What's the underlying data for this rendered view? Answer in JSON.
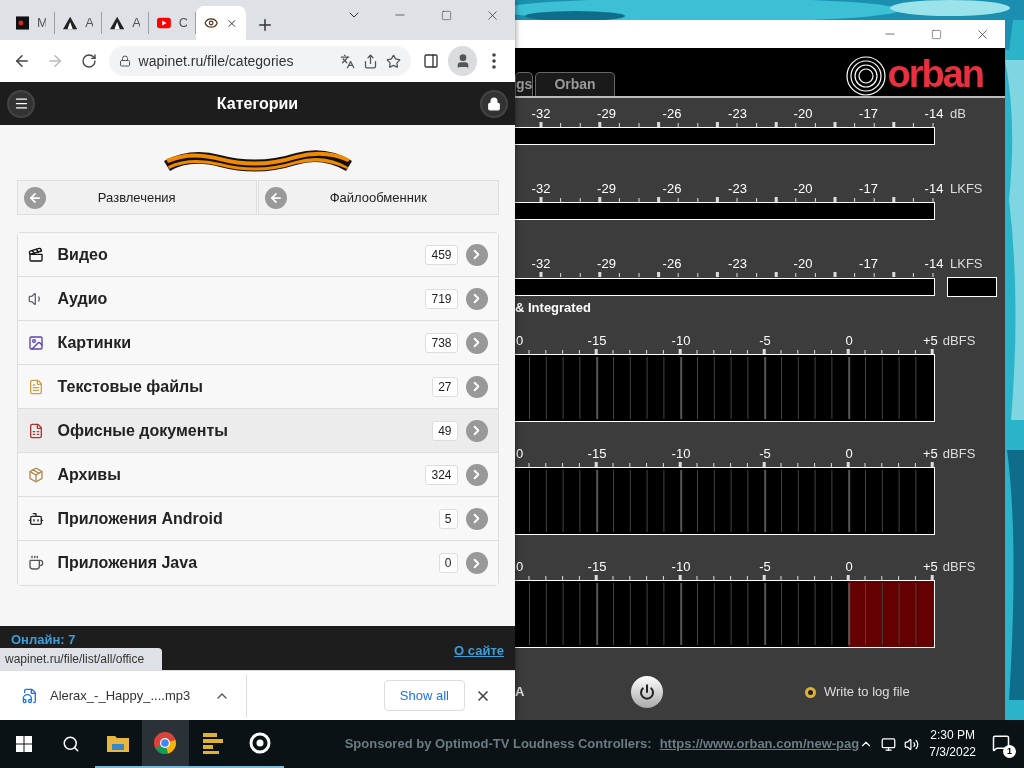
{
  "browser": {
    "tabs": [
      {
        "title": "M",
        "selected": false
      },
      {
        "title": "A",
        "selected": false
      },
      {
        "title": "A",
        "selected": false
      },
      {
        "title": "C",
        "selected": false
      },
      {
        "selected": true
      }
    ],
    "forward": {
      "disabled": true
    },
    "url": "wapinet.ru/file/categories",
    "page": {
      "title": "Категории",
      "nav": [
        "Развлечения",
        "Файлообменник"
      ],
      "categories": [
        {
          "label": "Видео",
          "count": "459",
          "highlighted": false
        },
        {
          "label": "Аудио",
          "count": "719",
          "highlighted": false
        },
        {
          "label": "Картинки",
          "count": "738",
          "highlighted": false
        },
        {
          "label": "Текстовые файлы",
          "count": "27",
          "highlighted": false
        },
        {
          "label": "Офисные документы",
          "count": "49",
          "highlighted": true
        },
        {
          "label": "Архивы",
          "count": "324",
          "highlighted": false
        },
        {
          "label": "Приложения Android",
          "count": "5",
          "highlighted": false
        },
        {
          "label": "Приложения Java",
          "count": "0",
          "highlighted": false
        }
      ],
      "online": "Онлайн: 7",
      "about": "О сайте"
    },
    "status_url": "wapinet.ru/file/list/all/office",
    "download": {
      "file": "Alerax_-_Happy_....mp3",
      "show_all": "Show all"
    }
  },
  "orban": {
    "tabs": [
      "gs",
      "Orban"
    ],
    "logo": "orban",
    "loudness_meters": [
      {
        "scale": [
          "-32",
          "-29",
          "-26",
          "-23",
          "-20",
          "-17",
          "-14"
        ],
        "unit": "dB",
        "level": 0
      },
      {
        "scale": [
          "-32",
          "-29",
          "-26",
          "-23",
          "-20",
          "-17",
          "-14"
        ],
        "unit": "LKFS",
        "level": 0
      },
      {
        "scale": [
          "-32",
          "-29",
          "-26",
          "-23",
          "-20",
          "-17",
          "-14"
        ],
        "unit": "LKFS",
        "level": 0,
        "readout": true
      }
    ],
    "section_label": "& Integrated",
    "peak_meters": [
      {
        "scale": [
          "0",
          "-15",
          "-10",
          "-5",
          "0",
          "+5"
        ],
        "unit": "dBFS",
        "overload": false
      },
      {
        "scale": [
          "0",
          "-15",
          "-10",
          "-5",
          "0",
          "+5"
        ],
        "unit": "dBFS",
        "overload": false
      },
      {
        "scale": [
          "0",
          "-15",
          "-10",
          "-5",
          "0",
          "+5"
        ],
        "unit": "dBFS",
        "overload": true
      }
    ],
    "cut_label": "A",
    "log_option": {
      "label": "Write to log file",
      "checked": true
    }
  },
  "taskbar": {
    "apps": [
      {
        "active": false
      },
      {
        "active": true
      },
      {
        "active": false
      },
      {
        "active": false
      }
    ],
    "sponsor": "Sponsored by Optimod-TV Loudness Controllers:",
    "sponsor_link": "https://www.orban.com/new-pag",
    "time": "2:30 PM",
    "date": "7/3/2022",
    "notifications": "1"
  }
}
